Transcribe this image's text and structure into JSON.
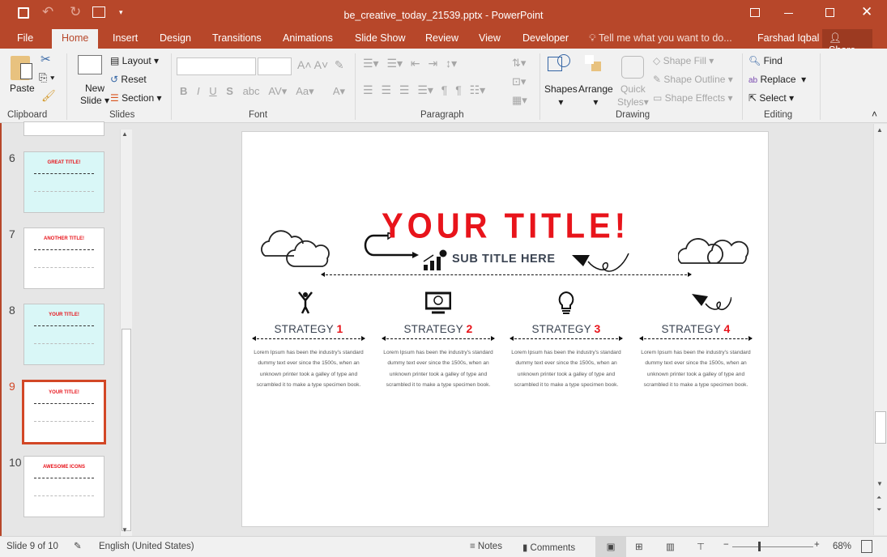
{
  "window": {
    "title": "be_creative_today_21539.pptx - PowerPoint",
    "user": "Farshad Iqbal",
    "share": "Share",
    "tell_me": "Tell me what you want to do..."
  },
  "tabs": [
    "File",
    "Home",
    "Insert",
    "Design",
    "Transitions",
    "Animations",
    "Slide Show",
    "Review",
    "View",
    "Developer"
  ],
  "ribbon": {
    "clipboard": {
      "paste": "Paste",
      "label": "Clipboard"
    },
    "slides": {
      "new_slide_1": "New",
      "new_slide_2": "Slide",
      "layout": "Layout",
      "reset": "Reset",
      "section": "Section",
      "label": "Slides"
    },
    "font": {
      "label": "Font",
      "font_value": "",
      "size_value": ""
    },
    "paragraph": {
      "label": "Paragraph"
    },
    "drawing": {
      "shapes": "Shapes",
      "arrange": "Arrange",
      "quick_1": "Quick",
      "quick_2": "Styles",
      "shape_fill": "Shape Fill",
      "shape_outline": "Shape Outline",
      "shape_effects": "Shape Effects",
      "label": "Drawing"
    },
    "editing": {
      "find": "Find",
      "replace": "Replace",
      "select": "Select",
      "label": "Editing"
    }
  },
  "thumbnails": [
    {
      "num": "6",
      "title": "GREAT TITLE!",
      "bg": "#d9f7f7"
    },
    {
      "num": "7",
      "title": "ANOTHER TITLE!",
      "bg": "#ffffff"
    },
    {
      "num": "8",
      "title": "YOUR TITLE!",
      "bg": "#d9f7f7"
    },
    {
      "num": "9",
      "title": "YOUR TITLE!",
      "bg": "#ffffff",
      "selected": true
    },
    {
      "num": "10",
      "title": "AWESOME ICONS",
      "bg": "#ffffff"
    }
  ],
  "slide": {
    "title": "YOUR TITLE!",
    "subtitle": "SUB TITLE HERE",
    "strategies": [
      {
        "label": "STRATEGY ",
        "num": "1",
        "icon": "person-icon"
      },
      {
        "label": "STRATEGY ",
        "num": "2",
        "icon": "monitor-icon"
      },
      {
        "label": "STRATEGY ",
        "num": "3",
        "icon": "lightbulb-icon"
      },
      {
        "label": "STRATEGY ",
        "num": "4",
        "icon": "paper-plane-icon"
      }
    ],
    "lorem": "Lorem Ipsum has been the industry's standard dummy text ever since the 1500s, when an unknown printer took a galley of type and scrambled it to make a type specimen book."
  },
  "status": {
    "slide": "Slide 9 of 10",
    "language": "English (United States)",
    "notes": "Notes",
    "comments": "Comments",
    "zoom": "68%",
    "zoom_percent": 68
  },
  "colors": {
    "accent": "#b7472a",
    "title_red": "#e8141b",
    "subtitle": "#3b4452"
  }
}
